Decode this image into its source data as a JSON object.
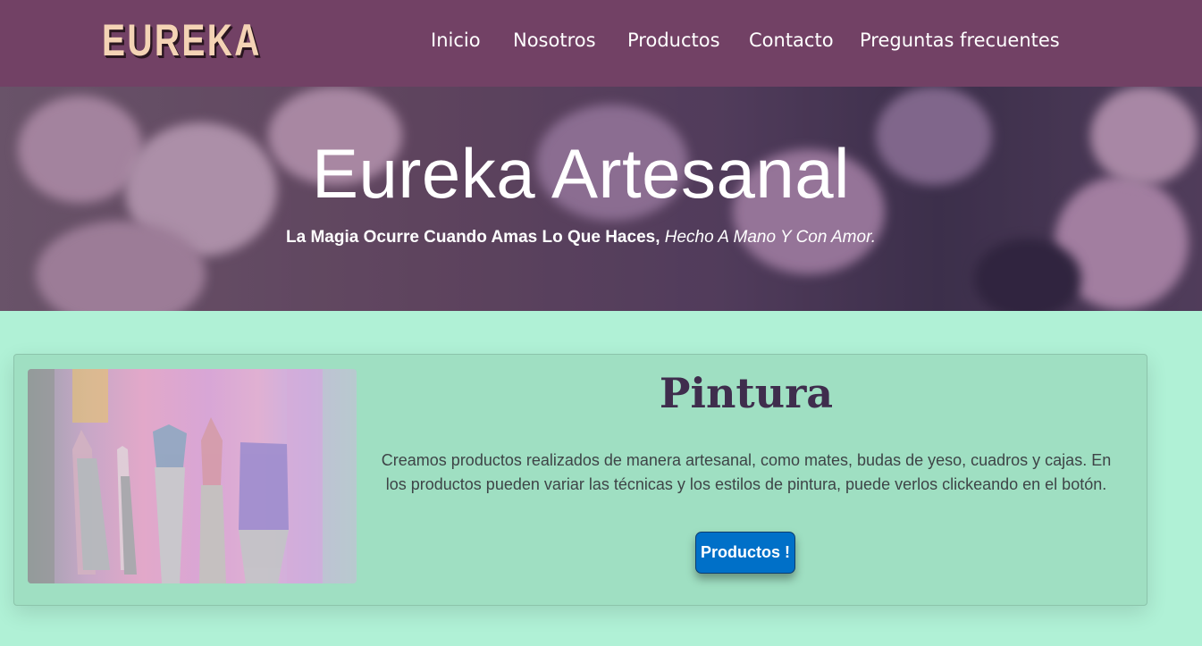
{
  "navbar": {
    "logo": "EUREKA",
    "items": [
      {
        "label": "Inicio"
      },
      {
        "label": "Nosotros"
      },
      {
        "label": "Productos"
      },
      {
        "label": "Contacto"
      },
      {
        "label": "Preguntas frecuentes"
      }
    ],
    "background": "#724165"
  },
  "hero": {
    "title": "Eureka Artesanal",
    "subtitle_strong": "La Magia Ocurre Cuando Amas Lo Que Haces,",
    "subtitle_em": "Hecho A Mano Y Con Amor."
  },
  "card": {
    "title": "Pintura",
    "text": "Creamos productos realizados de manera artesanal, como mates, budas de yeso, cuadros y cajas. En los productos pueden variar las técnicas y los estilos de pintura, puede verlos clickeando en el botón.",
    "button_label": "Productos !",
    "image_icon": "paint-brushes-icon"
  },
  "colors": {
    "page_background": "#b0f1d6",
    "card_background": "#9fdfc2",
    "accent_button": "#0070c8",
    "title_color": "#3f2d4d"
  }
}
